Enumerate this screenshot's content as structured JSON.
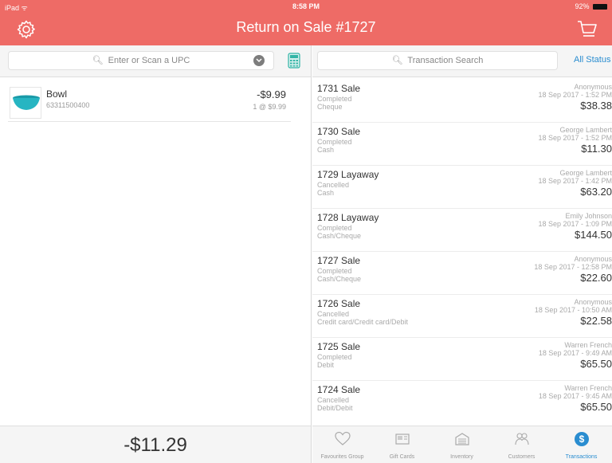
{
  "status_bar": {
    "carrier": "iPad ᯤ",
    "time": "8:58 PM",
    "battery": "92%"
  },
  "header": {
    "title": "Return on Sale #1727"
  },
  "left": {
    "upc_placeholder": "Enter or Scan a UPC",
    "items": [
      {
        "name": "Bowl",
        "sku": "63311500400",
        "price": "-$9.99",
        "qty": "1 @ $9.99"
      }
    ],
    "total": "-$11.29"
  },
  "right": {
    "search_placeholder": "Transaction Search",
    "status_filter": "All Status",
    "transactions": [
      {
        "title": "1731 Sale",
        "status": "Completed",
        "payment": "Cheque",
        "customer": "Anonymous",
        "date": "18 Sep 2017 - 1:52 PM",
        "amount": "$38.38"
      },
      {
        "title": "1730 Sale",
        "status": "Completed",
        "payment": "Cash",
        "customer": "George Lambert",
        "date": "18 Sep 2017 - 1:52 PM",
        "amount": "$11.30"
      },
      {
        "title": "1729 Layaway",
        "status": "Cancelled",
        "payment": "Cash",
        "customer": "George Lambert",
        "date": "18 Sep 2017 - 1:42 PM",
        "amount": "$63.20"
      },
      {
        "title": "1728 Layaway",
        "status": "Completed",
        "payment": "Cash/Cheque",
        "customer": "Emily Johnson",
        "date": "18 Sep 2017 - 1:09 PM",
        "amount": "$144.50"
      },
      {
        "title": "1727 Sale",
        "status": "Completed",
        "payment": "Cash/Cheque",
        "customer": "Anonymous",
        "date": "18 Sep 2017 - 12:58 PM",
        "amount": "$22.60"
      },
      {
        "title": "1726 Sale",
        "status": "Cancelled",
        "payment": "Credit card/Credit card/Debit",
        "customer": "Anonymous",
        "date": "18 Sep 2017 - 10:50 AM",
        "amount": "$22.58"
      },
      {
        "title": "1725 Sale",
        "status": "Completed",
        "payment": "Debit",
        "customer": "Warren French",
        "date": "18 Sep 2017 - 9:49 AM",
        "amount": "$65.50"
      },
      {
        "title": "1724 Sale",
        "status": "Cancelled",
        "payment": "Debit/Debit",
        "customer": "Warren French",
        "date": "18 Sep 2017 - 9:45 AM",
        "amount": "$65.50"
      }
    ]
  },
  "tabs": [
    {
      "label": "Favourites Group",
      "icon": "heart-icon"
    },
    {
      "label": "Gift Cards",
      "icon": "gift-card-icon"
    },
    {
      "label": "Inventory",
      "icon": "inventory-icon"
    },
    {
      "label": "Customers",
      "icon": "customers-icon"
    },
    {
      "label": "Transactions",
      "icon": "transactions-icon",
      "active": true
    }
  ],
  "colors": {
    "header": "#ee6b66",
    "accent": "#2a8dd0",
    "bowl": "#27b5c2"
  }
}
